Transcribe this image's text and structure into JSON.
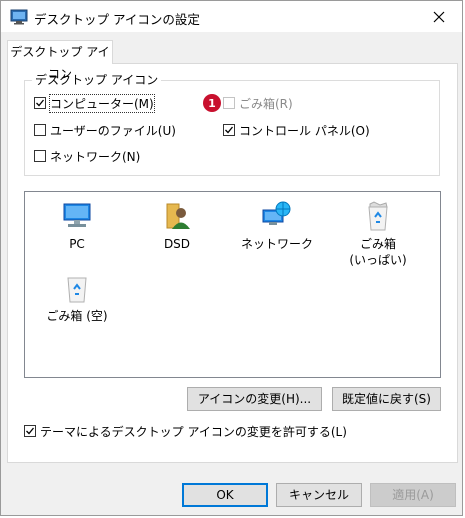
{
  "window": {
    "title": "デスクトップ アイコンの設定"
  },
  "tabs": [
    {
      "label": "デスクトップ アイコン"
    }
  ],
  "group": {
    "label": "デスクトップ アイコン",
    "checkboxes": [
      {
        "id": "computer",
        "label": "コンピューター(M)",
        "checked": true,
        "enabled": true
      },
      {
        "id": "recycle",
        "label": "ごみ箱(R)",
        "checked": false,
        "enabled": false
      },
      {
        "id": "userfiles",
        "label": "ユーザーのファイル(U)",
        "checked": false,
        "enabled": true
      },
      {
        "id": "controlpanel",
        "label": "コントロール パネル(O)",
        "checked": true,
        "enabled": true
      },
      {
        "id": "network",
        "label": "ネットワーク(N)",
        "checked": false,
        "enabled": true
      }
    ]
  },
  "marker": {
    "number": "1"
  },
  "icon_list": {
    "items": [
      {
        "label": "PC",
        "icon": "pc-icon"
      },
      {
        "label": "DSD",
        "icon": "user-folder-icon"
      },
      {
        "label": "ネットワーク",
        "icon": "network-icon"
      },
      {
        "label": "ごみ箱",
        "label2": "(いっぱい)",
        "icon": "recycle-bin-full-icon"
      },
      {
        "label": "ごみ箱 (空)",
        "icon": "recycle-bin-empty-icon"
      }
    ]
  },
  "buttons": {
    "change_icon": "アイコンの変更(H)...",
    "restore_default": "既定値に戻す(S)",
    "ok": "OK",
    "cancel": "キャンセル",
    "apply": "適用(A)"
  },
  "theme_checkbox": {
    "label": "テーマによるデスクトップ アイコンの変更を許可する(L)",
    "checked": true
  },
  "colors": {
    "accent": "#0078d7",
    "marker": "#c8102e",
    "dialog_bg": "#f0f0f0"
  }
}
